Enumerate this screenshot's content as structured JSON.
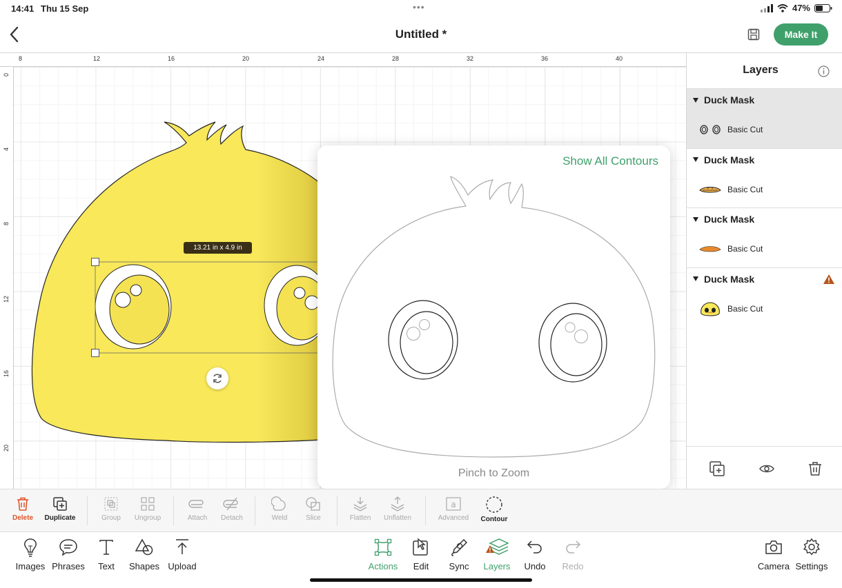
{
  "status": {
    "time": "14:41",
    "date": "Thu 15 Sep",
    "battery": "47%",
    "dots": "•••"
  },
  "header": {
    "title": "Untitled *",
    "make_it": "Make It"
  },
  "ruler": {
    "top": [
      "8",
      "12",
      "16",
      "20",
      "24",
      "28",
      "32",
      "36",
      "40"
    ],
    "left": [
      "0",
      "4",
      "8",
      "12",
      "16",
      "20"
    ]
  },
  "canvas": {
    "size_label": "13.21 in x 4.9 in",
    "fill_color": "#f8e85a"
  },
  "popover": {
    "show_all": "Show All Contours",
    "pinch": "Pinch to Zoom"
  },
  "layers": {
    "title": "Layers",
    "groups": [
      {
        "name": "Duck Mask",
        "item": "Basic Cut"
      },
      {
        "name": "Duck Mask",
        "item": "Basic Cut"
      },
      {
        "name": "Duck Mask",
        "item": "Basic Cut"
      },
      {
        "name": "Duck Mask",
        "item": "Basic Cut"
      }
    ]
  },
  "actions": {
    "delete": "Delete",
    "duplicate": "Duplicate",
    "group": "Group",
    "ungroup": "Ungroup",
    "attach": "Attach",
    "detach": "Detach",
    "weld": "Weld",
    "slice": "Slice",
    "flatten": "Flatten",
    "unflatten": "Unflatten",
    "advanced": "Advanced",
    "contour": "Contour"
  },
  "toolbar": {
    "images": "Images",
    "phrases": "Phrases",
    "text": "Text",
    "shapes": "Shapes",
    "upload": "Upload",
    "actions": "Actions",
    "edit": "Edit",
    "sync": "Sync",
    "layers": "Layers",
    "undo": "Undo",
    "redo": "Redo",
    "camera": "Camera",
    "settings": "Settings"
  },
  "colors": {
    "accent": "#3fa06b",
    "delete": "#e0552a",
    "warning": "#b5541c"
  }
}
